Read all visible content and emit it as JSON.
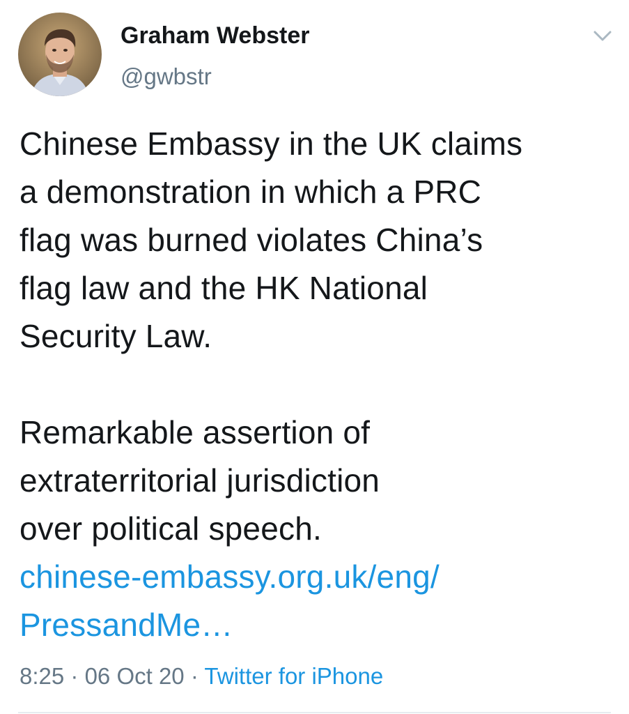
{
  "user": {
    "display_name": "Graham Webster",
    "handle": "@gwbstr"
  },
  "tweet": {
    "text_lines": [
      "Chinese Embassy in the UK claims",
      "a demonstration in which a PRC",
      "flag was burned violates China’s",
      "flag law and the HK National",
      "Security Law."
    ],
    "text_lines_2": [
      "Remarkable assertion of",
      "extraterritorial jurisdiction",
      "over political speech."
    ],
    "link_lines": [
      "chinese-embassy.org.uk/eng/",
      "PressandMe…"
    ]
  },
  "meta": {
    "time": "8:25",
    "separator": "·",
    "date": "06 Oct 20",
    "source": "Twitter for iPhone"
  },
  "colors": {
    "text": "#14171a",
    "secondary": "#657786",
    "link": "#1b95e0",
    "divider": "#e6ecf0"
  },
  "icons": {
    "menu": "chevron-down-icon",
    "avatar": "profile-photo"
  }
}
